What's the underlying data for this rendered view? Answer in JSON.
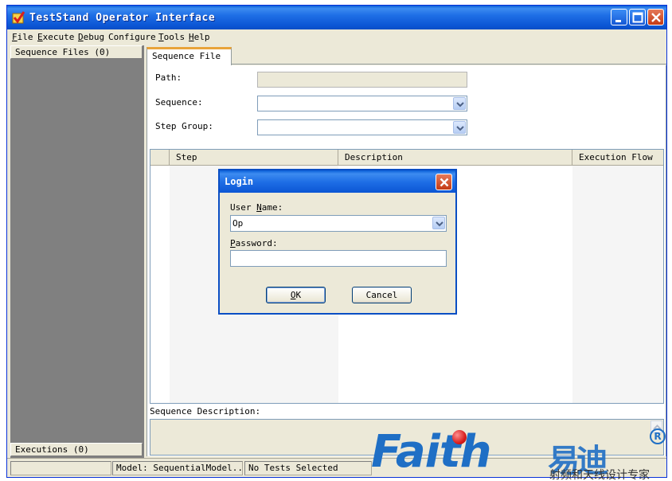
{
  "window": {
    "title": "TestStand Operator Interface"
  },
  "menu": {
    "items": [
      {
        "mnemonic": "F",
        "rest": "ile"
      },
      {
        "mnemonic": "E",
        "rest": "xecute"
      },
      {
        "mnemonic": "D",
        "rest": "ebug"
      },
      {
        "mnemonic": "",
        "rest": "Configure"
      },
      {
        "mnemonic": "T",
        "rest": "ools"
      },
      {
        "mnemonic": "H",
        "rest": "elp"
      }
    ]
  },
  "left_panel": {
    "sequence_files_label": "Sequence Files (0)",
    "executions_label": "Executions (0)"
  },
  "tab": {
    "label": "Sequence File"
  },
  "form": {
    "path_label": "Path:",
    "path_value": "",
    "sequence_label": "Sequence:",
    "sequence_value": "",
    "step_group_label": "Step Group:",
    "step_group_value": ""
  },
  "grid": {
    "columns": [
      "Step",
      "Description",
      "Execution Flow"
    ]
  },
  "sequence_description": {
    "label": "Sequence Description:"
  },
  "status": {
    "model": "Model: SequentialModel...",
    "tests": "No Tests Selected"
  },
  "login_dialog": {
    "title": "Login",
    "user_name_mnemonic": "N",
    "user_name_pre": "User ",
    "user_name_post": "ame:",
    "user_name_value": "Op",
    "password_mnemonic": "P",
    "password_post": "assword:",
    "password_value": "",
    "ok_mnemonic": "O",
    "ok_post": "K",
    "cancel_label": "Cancel"
  },
  "watermark": {
    "brand": "Faith",
    "cn_name": "易迪",
    "registered": "R",
    "tagline": "射频和天线设计专家"
  },
  "colors": {
    "titlebar": "#0b55d4",
    "window_bg": "#ece9d8",
    "left_panel_bg": "#808080",
    "tab_accent": "#e8a33a",
    "watermark_blue": "#1f6fc5",
    "watermark_dot": "#d81e1e"
  }
}
